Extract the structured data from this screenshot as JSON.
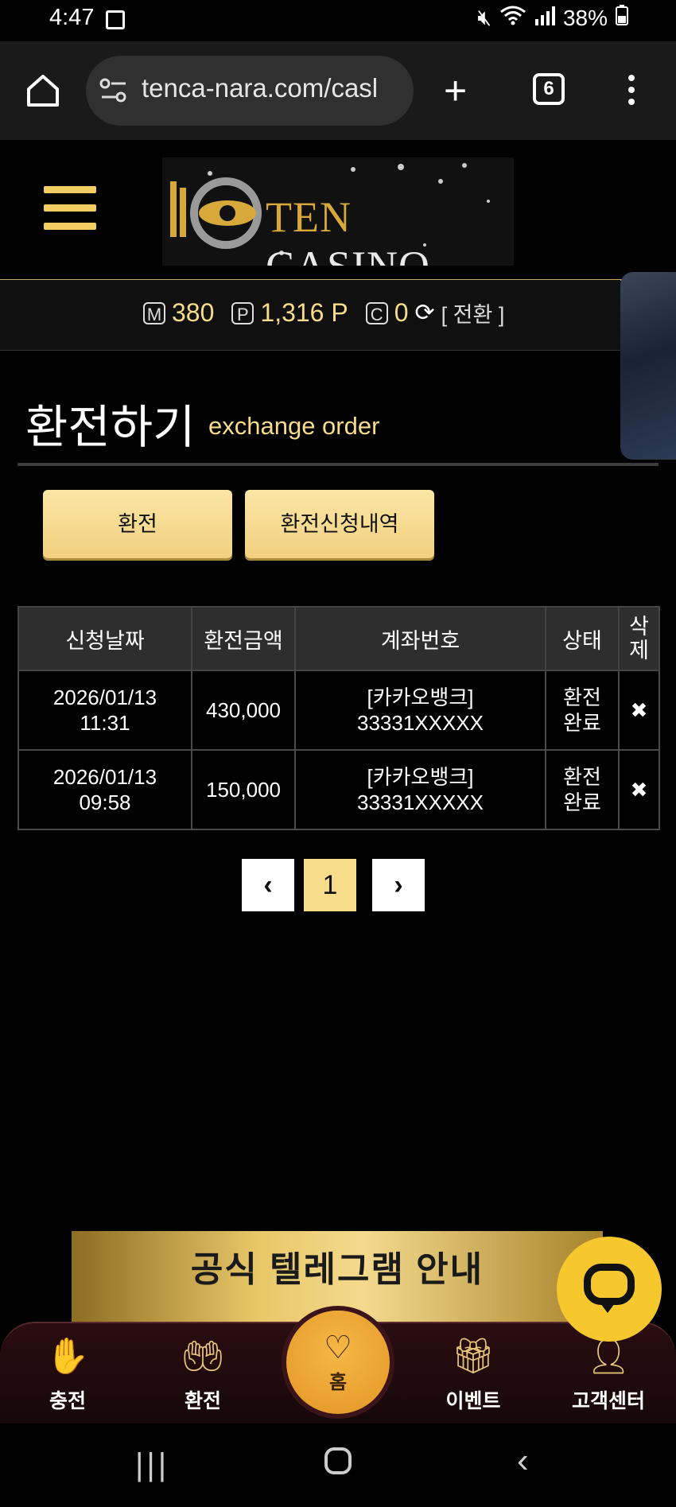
{
  "status": {
    "time": "4:47",
    "battery": "38%",
    "signal_icons": "wifi-hd-voice-signal"
  },
  "browser": {
    "url": "tenca-nara.com/casl",
    "tab_count": "6"
  },
  "header": {
    "logo_ten": "TEN",
    "logo_casino": "CASINO"
  },
  "points": {
    "m_label": "M",
    "m_value": "380",
    "p_label": "P",
    "p_value": "1,316 P",
    "c_label": "C",
    "c_value": "0",
    "convert": "[ 전환 ]"
  },
  "page": {
    "title": "환전하기",
    "subtitle": "exchange order"
  },
  "buttons": {
    "exchange": "환전",
    "history": "환전신청내역"
  },
  "table": {
    "headers": [
      "신청날짜",
      "환전금액",
      "계좌번호",
      "상태",
      "삭\n제"
    ],
    "rows": [
      {
        "date": "2026/01/13",
        "time": "11:31",
        "amount": "430,000",
        "bank": "[카카오뱅크]",
        "account": "33331XXXXX",
        "status1": "환전",
        "status2": "완료",
        "del": "✖"
      },
      {
        "date": "2026/01/13",
        "time": "09:58",
        "amount": "150,000",
        "bank": "[카카오뱅크]",
        "account": "33331XXXXX",
        "status1": "환전",
        "status2": "완료",
        "del": "✖"
      }
    ]
  },
  "pagination": {
    "prev": "‹",
    "current": "1",
    "next": "›"
  },
  "banner": {
    "telegram": "공식 텔레그램 안내"
  },
  "bottom_nav": {
    "charge": "충전",
    "exchange": "환전",
    "home": "홈",
    "event": "이벤트",
    "support": "고객센터"
  },
  "colors": {
    "accent": "#f7dc8c",
    "link": "#62a9ee",
    "button": "#f2d07f"
  }
}
